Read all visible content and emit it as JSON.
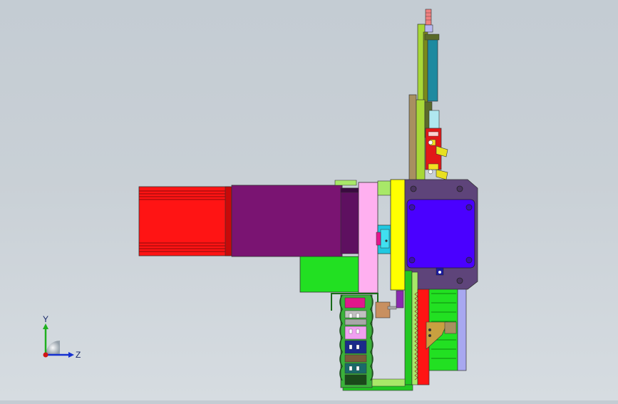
{
  "viewport": {
    "background_top": "#c4ccd3",
    "background_bottom": "#d6dce1"
  },
  "triad": {
    "y_label": "Y",
    "z_label": "Z",
    "y_color": "#1fb01f",
    "z_color": "#1530d0",
    "x_color": "#d01515"
  }
}
